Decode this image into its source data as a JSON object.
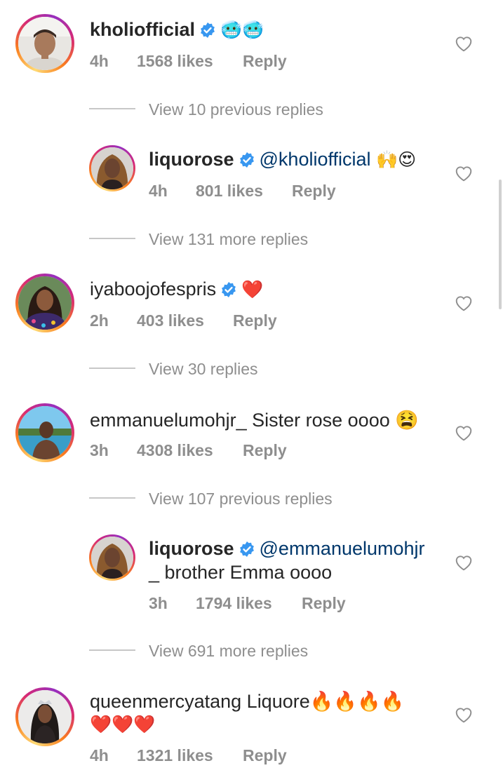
{
  "comments": [
    {
      "username": "kholiofficial",
      "text": "🥶🥶",
      "time": "4h",
      "likes": "1568 likes",
      "reply": "Reply"
    },
    {
      "view_replies": "View 10 previous replies"
    },
    {
      "username": "liquorose",
      "mention": "@kholiofficial",
      "text": "🙌😍",
      "time": "4h",
      "likes": "801 likes",
      "reply": "Reply"
    },
    {
      "view_replies": "View 131 more replies"
    },
    {
      "username": "iyaboojofespris",
      "text": "❤️",
      "time": "2h",
      "likes": "403 likes",
      "reply": "Reply"
    },
    {
      "view_replies": "View 30 replies"
    },
    {
      "username": "emmanuelumohjr_",
      "text": "Sister rose oooo 😫",
      "time": "3h",
      "likes": "4308 likes",
      "reply": "Reply"
    },
    {
      "view_replies": "View 107 previous replies"
    },
    {
      "username": "liquorose",
      "mention": "@emmanuelumohjr",
      "text_line2": "_ brother Emma  oooo",
      "time": "3h",
      "likes": "1794 likes",
      "reply": "Reply"
    },
    {
      "view_replies": "View 691 more replies"
    },
    {
      "username": "queenmercyatang",
      "text": "Liquore🔥🔥🔥🔥",
      "text_line2": "❤️❤️❤️",
      "time": "4h",
      "likes": "1321 likes",
      "reply": "Reply"
    }
  ],
  "colors": {
    "username": "#262626",
    "meta": "#8e8e8e",
    "mention": "#00376b",
    "verified": "#3897f0"
  },
  "icons": {
    "like": "heart-outline-icon",
    "verified": "verified-badge-icon"
  }
}
